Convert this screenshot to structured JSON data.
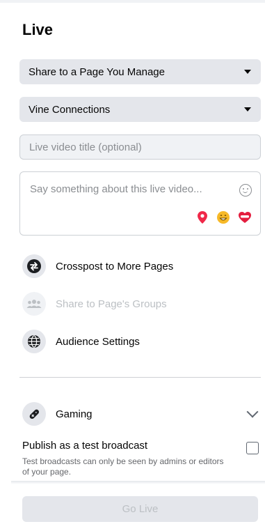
{
  "header": {
    "title": "Live"
  },
  "share_select": {
    "value": "Share to a Page You Manage"
  },
  "page_select": {
    "value": "Vine Connections"
  },
  "title_input": {
    "placeholder": "Live video title (optional)",
    "value": ""
  },
  "description": {
    "placeholder": "Say something about this live video..."
  },
  "options": {
    "crosspost": {
      "label": "Crosspost to More Pages",
      "icon": "crosspost-arrows-icon"
    },
    "groups": {
      "label": "Share to Page's Groups",
      "icon": "groups-icon"
    },
    "audience": {
      "label": "Audience Settings",
      "icon": "globe-icon"
    }
  },
  "gaming": {
    "label": "Gaming",
    "icon": "game-controller-icon"
  },
  "test_broadcast": {
    "title": "Publish as a test broadcast",
    "description": "Test broadcasts can only be seen by admins or editors of your page."
  },
  "footer": {
    "go_live_label": "Go Live"
  },
  "colors": {
    "accent_pin": "#f02849",
    "accent_face": "#f7b928",
    "accent_heart": "#e41e3f",
    "button_disabled": "#e4e6eb"
  }
}
